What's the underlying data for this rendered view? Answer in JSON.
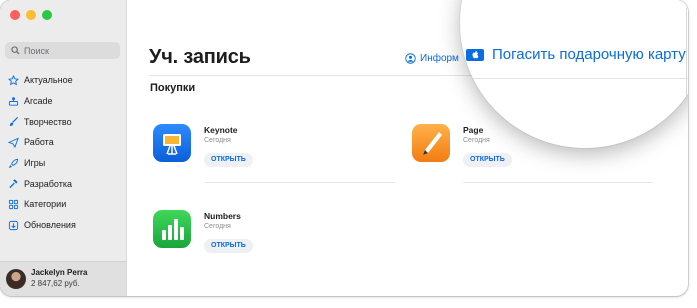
{
  "sidebar": {
    "search_placeholder": "Поиск",
    "items": [
      {
        "label": "Актуальное",
        "icon": "star-icon"
      },
      {
        "label": "Arcade",
        "icon": "arcade-icon"
      },
      {
        "label": "Творчество",
        "icon": "paintbrush-icon"
      },
      {
        "label": "Работа",
        "icon": "paperplane-icon"
      },
      {
        "label": "Игры",
        "icon": "rocket-icon"
      },
      {
        "label": "Разработка",
        "icon": "hammer-icon"
      },
      {
        "label": "Категории",
        "icon": "grid-icon"
      },
      {
        "label": "Обновления",
        "icon": "download-icon"
      }
    ],
    "account": {
      "name": "Jackelyn Perra",
      "balance": "2 847,62 руб."
    }
  },
  "main": {
    "title": "Уч. запись",
    "info_link": "Информ",
    "section": "Покупки",
    "apps": [
      {
        "name": "Keynote",
        "date": "Сегодня",
        "button": "ОТКРЫТЬ"
      },
      {
        "name": "Page",
        "date": "Сегодня",
        "button": "ОТКРЫТЬ"
      },
      {
        "name": "Numbers",
        "date": "Сегодня",
        "button": "ОТКРЫТЬ"
      }
    ]
  },
  "magnifier": {
    "redeem_label": "Погасить подарочную карту"
  },
  "colors": {
    "accent": "#0a6de0",
    "sidebar_bg": "#ececec"
  }
}
